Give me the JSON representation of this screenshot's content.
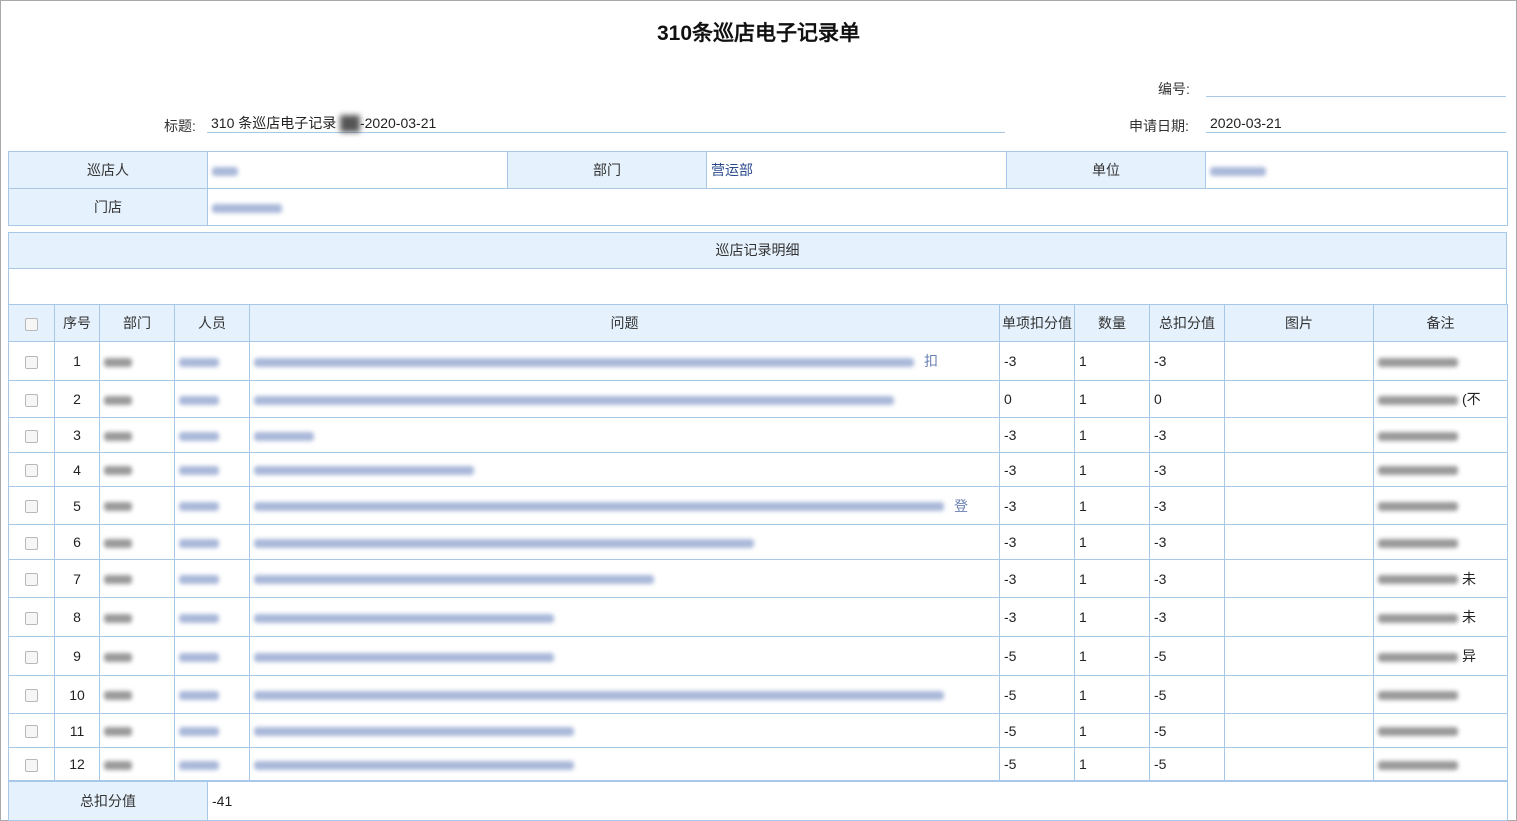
{
  "form": {
    "title": "310条巡店电子记录单",
    "number_label": "编号:",
    "number_value": "",
    "subject_label": "标题:",
    "subject_prefix": "310 条巡店电子记录",
    "subject_suffix": "-2020-03-21",
    "date_label": "申请日期:",
    "date_value": "2020-03-21"
  },
  "info": {
    "inspector_label": "巡店人",
    "dept_label": "部门",
    "dept_value": "营运部",
    "unit_label": "单位",
    "store_label": "门店"
  },
  "section_title": "巡店记录明细",
  "columns": {
    "seq": "序号",
    "dept": "部门",
    "person": "人员",
    "issue": "问题",
    "unit_deduct": "单项扣分值",
    "qty": "数量",
    "total_deduct": "总扣分值",
    "image": "图片",
    "remark": "备注"
  },
  "rows": [
    {
      "seq": "1",
      "unit": "-3",
      "qty": "1",
      "total": "-3",
      "issue_tail": "扣",
      "remark_tail": ""
    },
    {
      "seq": "2",
      "unit": "0",
      "qty": "1",
      "total": "0",
      "issue_tail": "",
      "remark_tail": "(不"
    },
    {
      "seq": "3",
      "unit": "-3",
      "qty": "1",
      "total": "-3",
      "issue_tail": "",
      "remark_tail": ""
    },
    {
      "seq": "4",
      "unit": "-3",
      "qty": "1",
      "total": "-3",
      "issue_tail": "",
      "remark_tail": ""
    },
    {
      "seq": "5",
      "unit": "-3",
      "qty": "1",
      "total": "-3",
      "issue_tail": "登",
      "remark_tail": ""
    },
    {
      "seq": "6",
      "unit": "-3",
      "qty": "1",
      "total": "-3",
      "issue_tail": "",
      "remark_tail": ""
    },
    {
      "seq": "7",
      "unit": "-3",
      "qty": "1",
      "total": "-3",
      "issue_tail": "",
      "remark_tail": "未"
    },
    {
      "seq": "8",
      "unit": "-3",
      "qty": "1",
      "total": "-3",
      "issue_tail": "",
      "remark_tail": "未"
    },
    {
      "seq": "9",
      "unit": "-5",
      "qty": "1",
      "total": "-5",
      "issue_tail": "",
      "remark_tail": "异"
    },
    {
      "seq": "10",
      "unit": "-5",
      "qty": "1",
      "total": "-5",
      "issue_tail": "",
      "remark_tail": ""
    },
    {
      "seq": "11",
      "unit": "-5",
      "qty": "1",
      "total": "-5",
      "issue_tail": "",
      "remark_tail": ""
    },
    {
      "seq": "12",
      "unit": "-5",
      "qty": "1",
      "total": "-5",
      "issue_tail": "",
      "remark_tail": ""
    }
  ],
  "footer": {
    "total_label": "总扣分值",
    "total_value": "-41"
  }
}
